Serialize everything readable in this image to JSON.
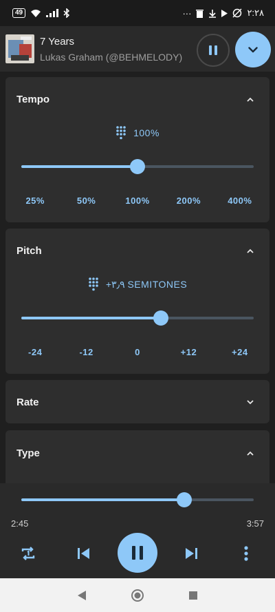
{
  "status_bar": {
    "battery": "49",
    "clock": "۲:۲۸",
    "more": "···"
  },
  "now_playing": {
    "title": "7 Years",
    "artist": "Lukas Graham (@BEHMELODY)"
  },
  "tempo": {
    "header": "Tempo",
    "value": "100%",
    "level": 0.5,
    "presets": [
      "25%",
      "50%",
      "100%",
      "200%",
      "400%"
    ]
  },
  "pitch": {
    "header": "Pitch",
    "value": "+۳٫۹ SEMITONES",
    "level": 0.6,
    "presets": [
      "-24",
      "-12",
      "0",
      "+12",
      "+24"
    ]
  },
  "rate": {
    "header": "Rate"
  },
  "type": {
    "header": "Type"
  },
  "playback": {
    "elapsed": "2:45",
    "total": "3:57",
    "progress": 0.7
  },
  "colors": {
    "accent": "#8ec8f8",
    "card": "#2e2e2e",
    "background": "#1f1f1f"
  }
}
